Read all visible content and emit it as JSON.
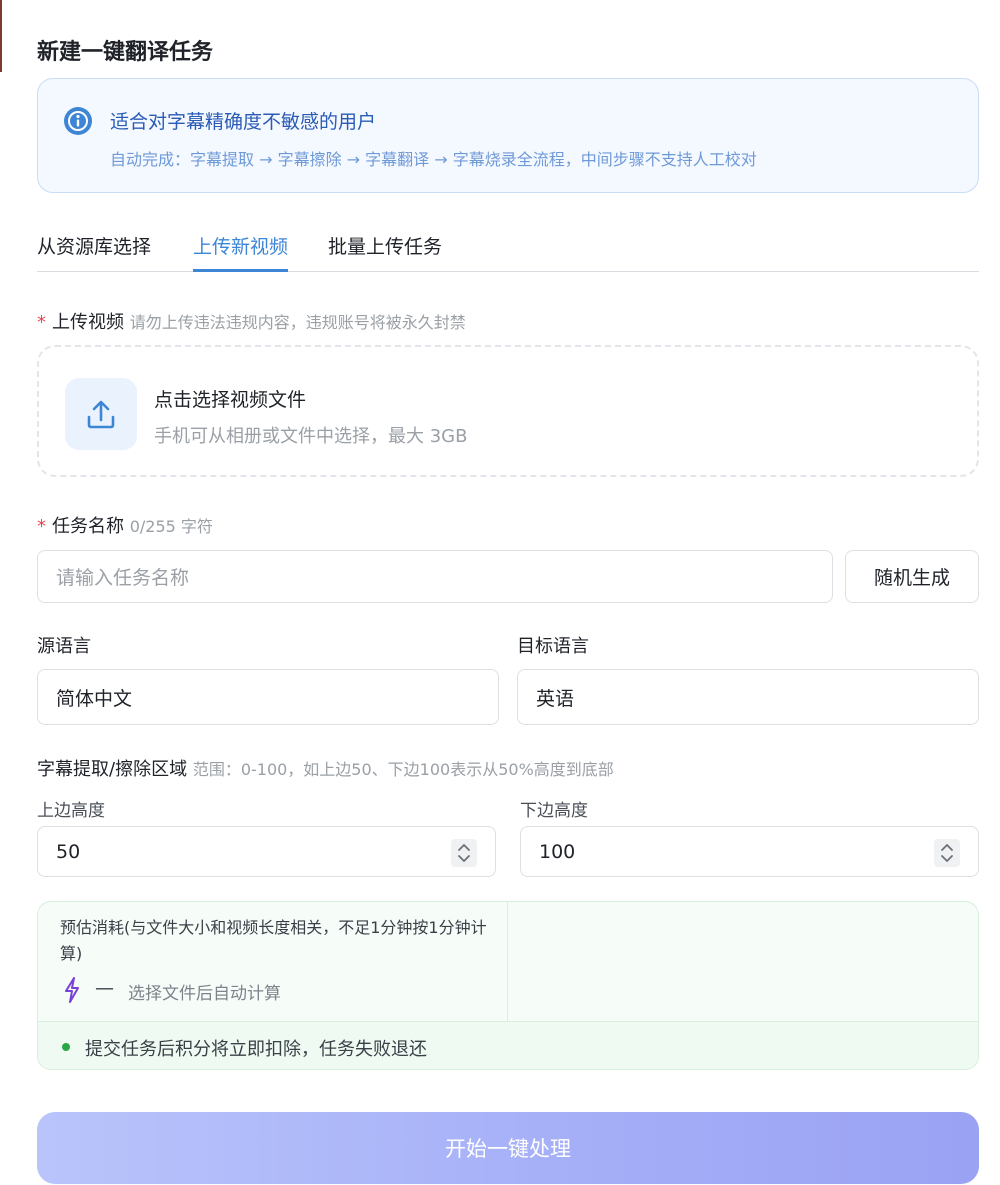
{
  "page": {
    "title": "新建一键翻译任务"
  },
  "notice": {
    "title": "适合对字幕精确度不敏感的用户",
    "description": "自动完成：字幕提取 → 字幕擦除 → 字幕翻译 → 字幕烧录全流程，中间步骤不支持人工校对",
    "icon": "info-icon",
    "accent_color": "#3d86d6"
  },
  "tabs": [
    {
      "label": "从资源库选择",
      "active": false
    },
    {
      "label": "上传新视频",
      "active": true
    },
    {
      "label": "批量上传任务",
      "active": false
    }
  ],
  "upload": {
    "required_mark": "*",
    "label": "上传视频",
    "hint": "请勿上传违法违规内容，违规账号将被永久封禁",
    "title": "点击选择视频文件",
    "subtitle": "手机可从相册或文件中选择，最大 3GB",
    "icon": "upload-icon"
  },
  "task_name": {
    "required_mark": "*",
    "label": "任务名称",
    "counter": "0/255 字符",
    "placeholder": "请输入任务名称",
    "value": "",
    "random_button": "随机生成"
  },
  "languages": {
    "source_label": "源语言",
    "source_value": "简体中文",
    "target_label": "目标语言",
    "target_value": "英语"
  },
  "region": {
    "label": "字幕提取/擦除区域",
    "hint": "范围：0-100，如上边50、下边100表示从50%高度到底部",
    "top_label": "上边高度",
    "top_value": "50",
    "bottom_label": "下边高度",
    "bottom_value": "100"
  },
  "cost": {
    "title": "预估消耗(与文件大小和视频长度相关，不足1分钟按1分钟计算)",
    "value": "—",
    "hint": "选择文件后自动计算",
    "icon": "lightning-icon",
    "note": "提交任务后积分将立即扣除，任务失败退还",
    "note_color": "#27a845"
  },
  "submit": {
    "label": "开始一键处理"
  }
}
